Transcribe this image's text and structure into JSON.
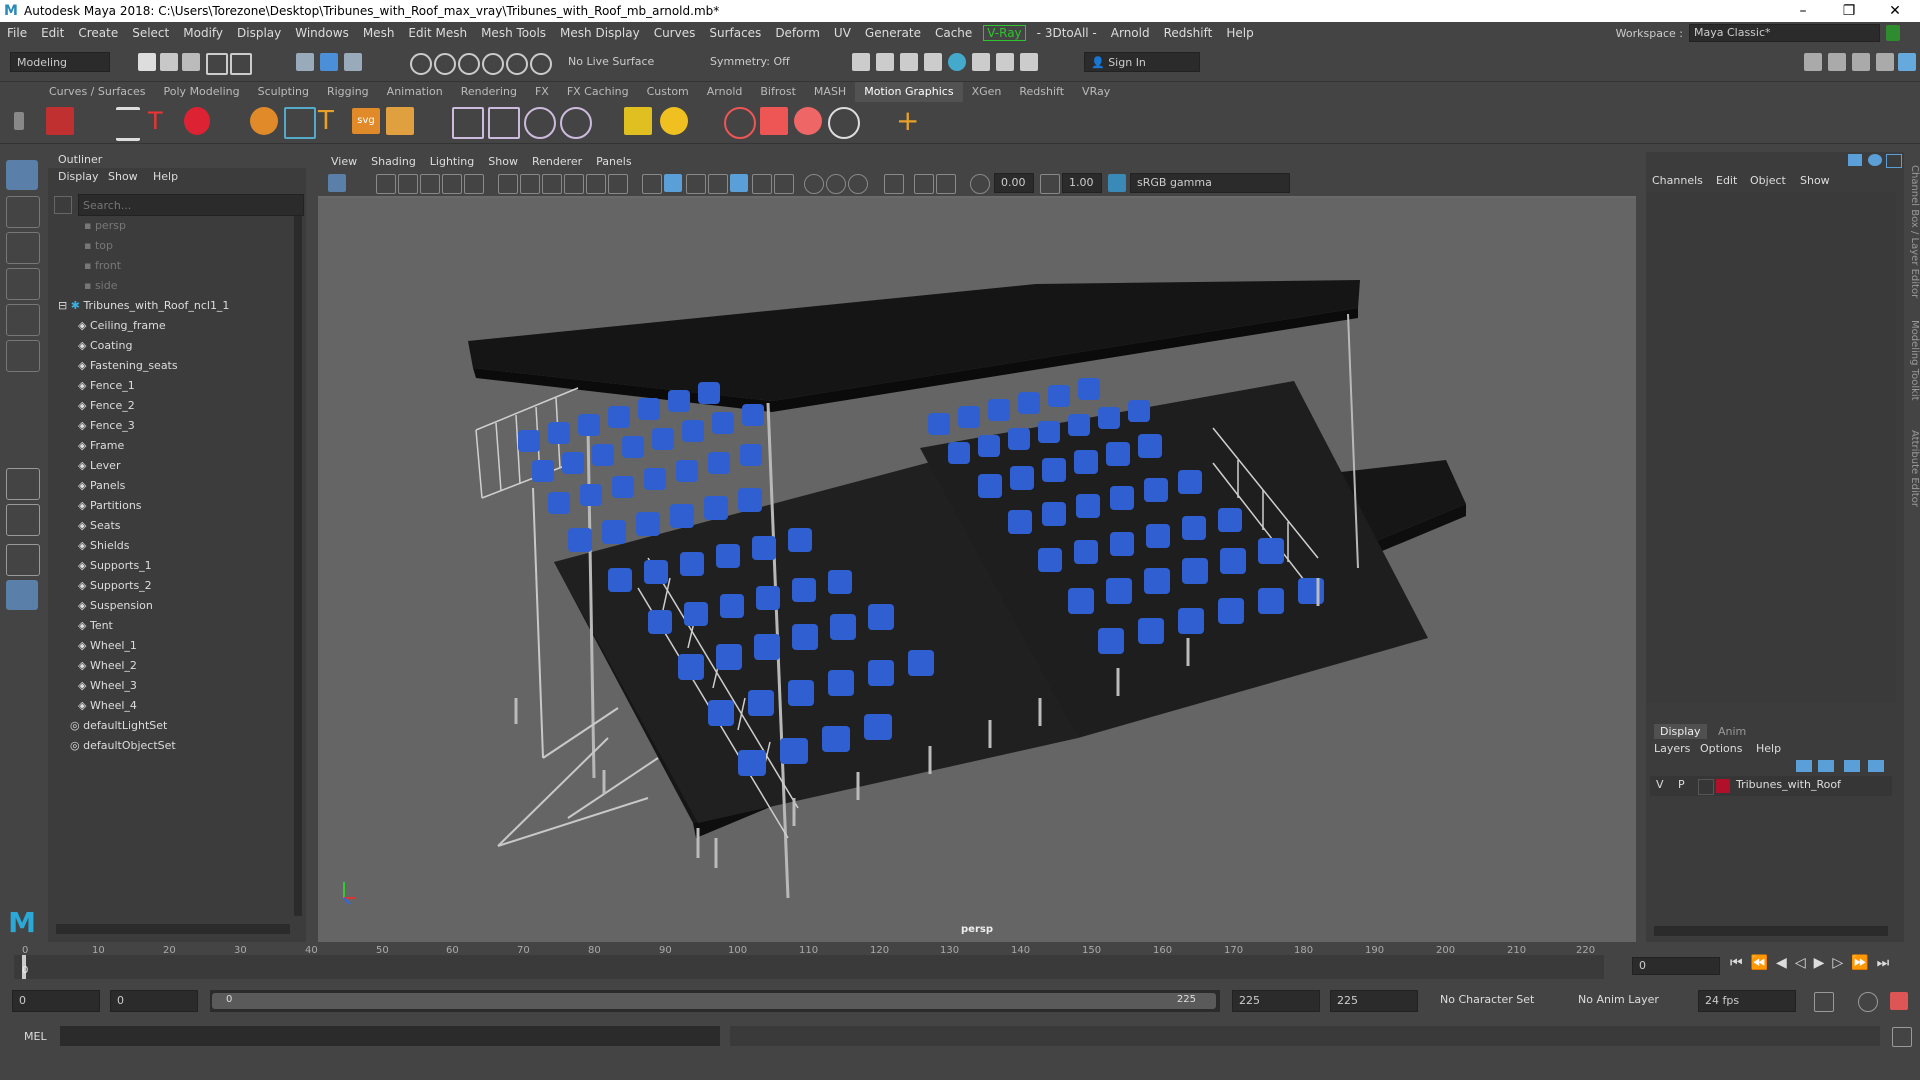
{
  "window": {
    "title": "Autodesk Maya 2018: C:\\Users\\Torezone\\Desktop\\Tribunes_with_Roof_max_vray\\Tribunes_with_Roof_mb_arnold.mb*",
    "minimize": "–",
    "restore": "❐",
    "close": "✕"
  },
  "menubar": {
    "items": [
      "File",
      "Edit",
      "Create",
      "Select",
      "Modify",
      "Display",
      "Windows",
      "Mesh",
      "Edit Mesh",
      "Mesh Tools",
      "Mesh Display",
      "Curves",
      "Surfaces",
      "Deform",
      "UV",
      "Generate",
      "Cache",
      "V-Ray",
      "- 3DtoAll -",
      "Arnold",
      "Redshift",
      "Help"
    ],
    "workspace_label": "Workspace :",
    "workspace_value": "Maya Classic*"
  },
  "statusline": {
    "mode": "Modeling",
    "live_surface": "No Live Surface",
    "symmetry": "Symmetry: Off",
    "sign_in": "Sign In"
  },
  "shelf": {
    "tabs": [
      "Curves / Surfaces",
      "Poly Modeling",
      "Sculpting",
      "Rigging",
      "Animation",
      "Rendering",
      "FX",
      "FX Caching",
      "Custom",
      "Arnold",
      "Bifrost",
      "MASH",
      "Motion Graphics",
      "XGen",
      "Redshift",
      "VRay"
    ],
    "active_tab": "Motion Graphics"
  },
  "outliner": {
    "title": "Outliner",
    "menus": [
      "Display",
      "Show",
      "Help"
    ],
    "search_placeholder": "Search...",
    "cameras": [
      "persp",
      "top",
      "front",
      "side"
    ],
    "root": "Tribunes_with_Roof_ncl1_1",
    "children": [
      "Ceiling_frame",
      "Coating",
      "Fastening_seats",
      "Fence_1",
      "Fence_2",
      "Fence_3",
      "Frame",
      "Lever",
      "Panels",
      "Partitions",
      "Seats",
      "Shields",
      "Supports_1",
      "Supports_2",
      "Suspension",
      "Tent",
      "Wheel_1",
      "Wheel_2",
      "Wheel_3",
      "Wheel_4"
    ],
    "sets": [
      "defaultLightSet",
      "defaultObjectSet"
    ]
  },
  "viewport": {
    "menus": [
      "View",
      "Shading",
      "Lighting",
      "Show",
      "Renderer",
      "Panels"
    ],
    "exposure": "0.00",
    "gamma": "1.00",
    "colorspace": "sRGB gamma",
    "camera_label": "persp"
  },
  "channelbox": {
    "menus": [
      "Channels",
      "Edit",
      "Object",
      "Show"
    ],
    "side_tabs": [
      "Channel Box / Layer Editor",
      "Modeling Toolkit",
      "Attribute Editor"
    ]
  },
  "layers": {
    "tabs": [
      "Display",
      "Anim"
    ],
    "active_tab": "Display",
    "menus": [
      "Layers",
      "Options",
      "Help"
    ],
    "layer": {
      "v": "V",
      "p": "P",
      "name": "Tribunes_with_Roof",
      "color": "#b0102a"
    }
  },
  "timeline": {
    "ticks": [
      "0",
      "10",
      "20",
      "30",
      "40",
      "50",
      "60",
      "70",
      "80",
      "90",
      "100",
      "110",
      "120",
      "130",
      "140",
      "150",
      "160",
      "170",
      "180",
      "190",
      "200",
      "210",
      "220"
    ],
    "current_frame": "0",
    "current_marker": "0"
  },
  "range": {
    "start": "0",
    "inner_start": "0",
    "slider_start": "0",
    "slider_end": "225",
    "end": "225",
    "outer_end": "225",
    "character_set": "No Character Set",
    "anim_layer": "No Anim Layer",
    "fps": "24 fps"
  },
  "cmdline": {
    "label": "MEL"
  },
  "colors": {
    "seat_blue": "#2f5fd0",
    "roof": "#141414",
    "accent_vray": "#2ec42e"
  }
}
